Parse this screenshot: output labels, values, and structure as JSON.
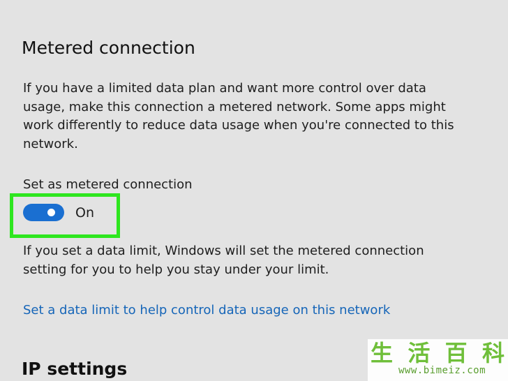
{
  "metered": {
    "title": "Metered connection",
    "description": "If you have a limited data plan and want more control over data usage, make this connection a metered network. Some apps might work differently to reduce data usage when you're connected to this network.",
    "toggle_label": "Set as metered connection",
    "toggle_state": "On",
    "toggle_on": true,
    "info": "If you set a data limit, Windows will set the metered connection setting for you to help you stay under your limit.",
    "link": "Set a data limit to help control data usage on this network"
  },
  "ip_settings": {
    "title": "IP settings"
  },
  "watermark": {
    "chars": [
      "生",
      "活",
      "百",
      "科"
    ],
    "url": "www.bimeiz.com"
  },
  "colors": {
    "background": "#e3e3e3",
    "accent": "#1a6fd1",
    "link": "#1565b8",
    "highlight": "#2ee61f",
    "watermark": "#6fbf3a"
  }
}
